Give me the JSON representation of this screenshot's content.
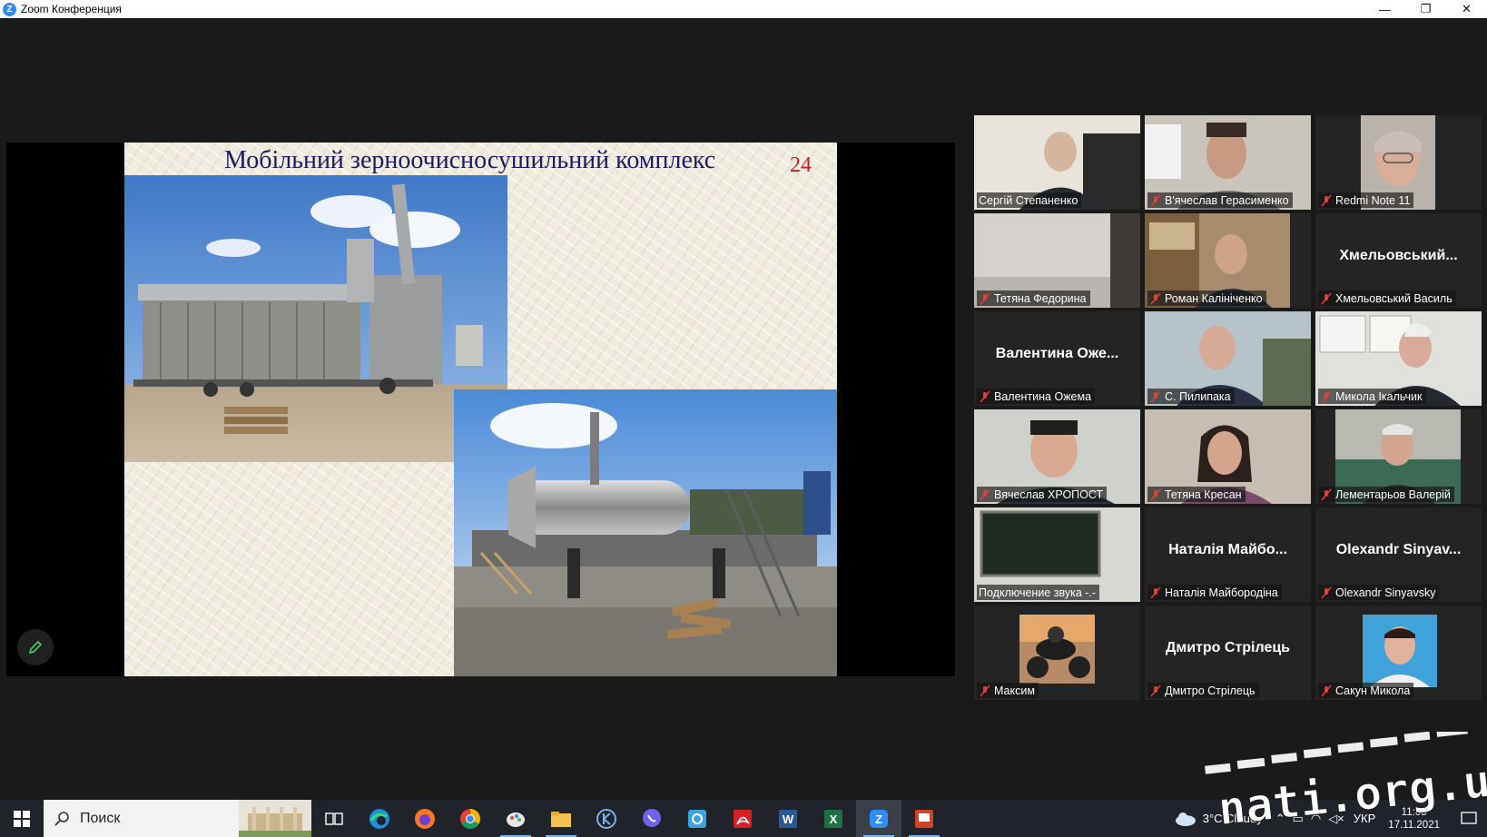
{
  "window": {
    "title": "Zoom Конференция",
    "minimize": "—",
    "maximize": "❐",
    "close": "✕"
  },
  "slide": {
    "title": "Мобільний зерноочисносушильний комплекс",
    "number": "24"
  },
  "participants": [
    {
      "name": "Сергій Степаненко",
      "muted": false,
      "video": true,
      "active": true
    },
    {
      "name": "В'ячеслав Герасименко",
      "muted": true,
      "video": true
    },
    {
      "name": "Redmi Note 11",
      "muted": true,
      "video": true
    },
    {
      "name": "Тетяна Федорина",
      "muted": true,
      "video": true
    },
    {
      "name": "Роман Калініченко",
      "muted": true,
      "video": true
    },
    {
      "name": "Хмельовський Василь",
      "display": "Хмельовський...",
      "muted": true,
      "video": false
    },
    {
      "name": "Валентина Ожема",
      "display": "Валентина Оже...",
      "muted": true,
      "video": false
    },
    {
      "name": "С. Пилипака",
      "muted": true,
      "video": true
    },
    {
      "name": "Микола Ікальчик",
      "muted": true,
      "video": true
    },
    {
      "name": "Вячеслав ХРОПОСТ",
      "muted": true,
      "video": true
    },
    {
      "name": "Тетяна Кресан",
      "muted": true,
      "video": true
    },
    {
      "name": "Лементарьов Валерій",
      "muted": true,
      "video": true
    },
    {
      "name": "Подключение звука -.-",
      "muted": false,
      "video": true
    },
    {
      "name": "Наталія Майбородіна",
      "display": "Наталія Майбо...",
      "muted": true,
      "video": false
    },
    {
      "name": "Olexandr Sinyavsky",
      "display": "Olexandr Sinyav...",
      "muted": true,
      "video": false
    },
    {
      "name": "Максим",
      "muted": true,
      "video": true
    },
    {
      "name": "Дмитро Стрілець",
      "display": "Дмитро Стрілець",
      "muted": true,
      "video": false
    },
    {
      "name": "Сакун Микола",
      "muted": true,
      "video": true
    }
  ],
  "taskbar": {
    "search_placeholder": "Поиск",
    "weather": "3°C  Cloudy",
    "language": "УКР",
    "time": "11:05",
    "date": "17.11.2021",
    "apps": [
      "task-view-icon",
      "edge-icon",
      "firefox-icon",
      "chrome-icon",
      "paint-icon",
      "explorer-icon",
      "kaspersky-icon",
      "viber-icon",
      "screenshot-icon",
      "acrobat-icon",
      "word-icon",
      "excel-icon",
      "zoom-icon",
      "powerpoint-icon"
    ]
  },
  "watermark": "nati.org.ua",
  "colors": {
    "active_speaker": "#e3e04a",
    "muted_icon": "#e0403a",
    "slide_title": "#1b1b60",
    "slide_number": "#c0201a"
  }
}
